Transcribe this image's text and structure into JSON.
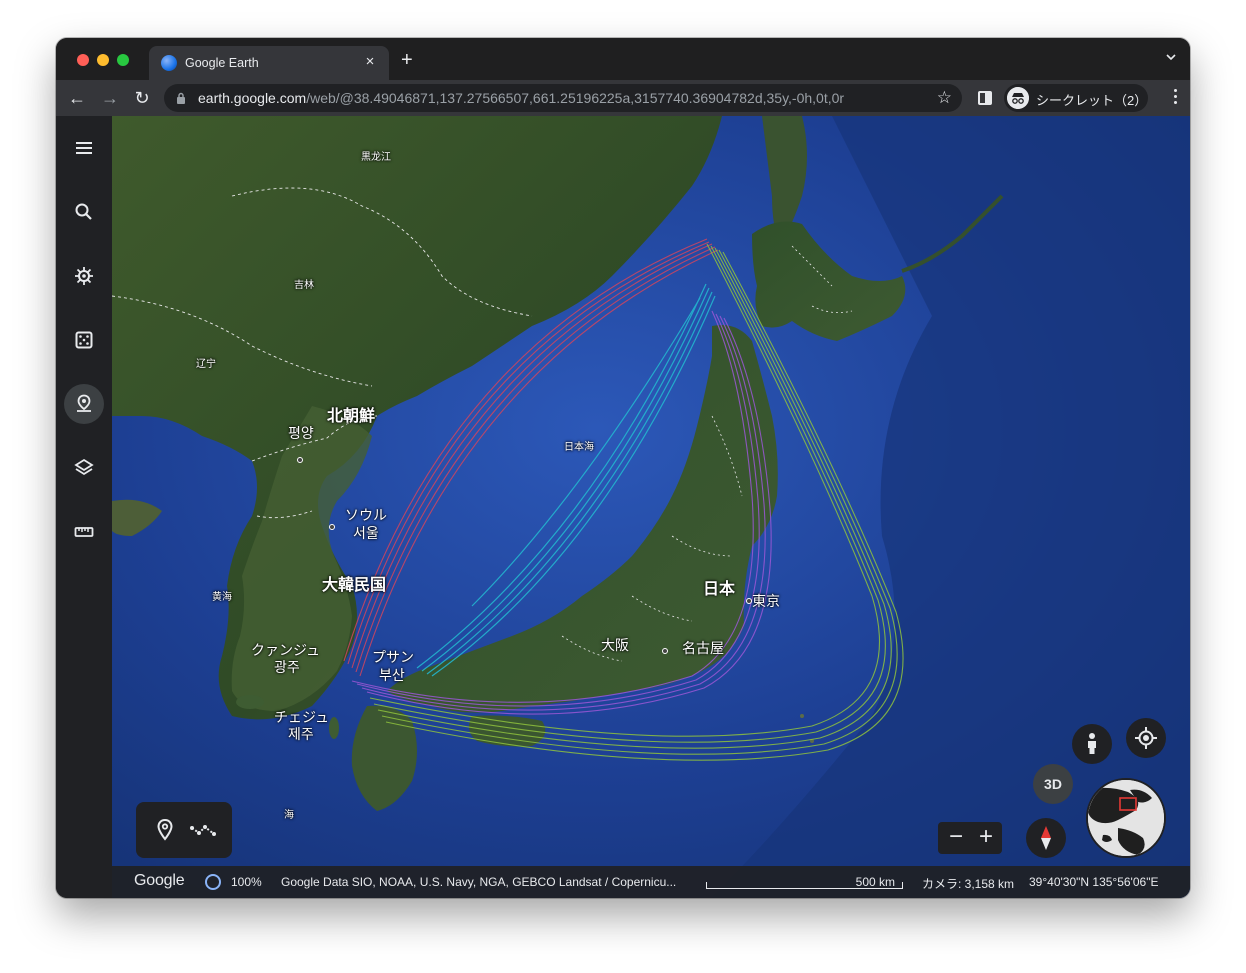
{
  "browser": {
    "tab_title": "Google Earth",
    "tab_close": "×",
    "new_tab": "+",
    "url_host": "earth.google.com",
    "url_path": "/web/@38.49046871,137.27566507,661.25196225a,3157740.36904782d,35y,-0h,0t,0r",
    "incognito_label": "シークレット（2）",
    "back": "←",
    "forward": "→",
    "reload": "↻",
    "star": "☆"
  },
  "sidebar": {
    "items": [
      {
        "name": "menu-icon"
      },
      {
        "name": "search-icon"
      },
      {
        "name": "voyager-icon"
      },
      {
        "name": "feeling-lucky-icon"
      },
      {
        "name": "projects-icon"
      },
      {
        "name": "map-style-icon"
      },
      {
        "name": "measure-icon"
      }
    ]
  },
  "map": {
    "labels": {
      "heilongjiang": "黒龙江",
      "jilin": "吉林",
      "liaoning": "辽宁",
      "north_korea": "北朝鮮",
      "pyongyang": "평양",
      "seoul_kana": "ソウル",
      "seoul": "서울",
      "south_korea": "大韓民国",
      "yellow_sea": "黄海",
      "gwangju_kana": "クァンジュ",
      "gwangju": "광주",
      "busan_kana": "プサン",
      "busan": "부산",
      "jeju_kana": "チェジュ",
      "jeju": "제주",
      "sea_of_japan": "日本海",
      "japan": "日本",
      "tokyo": "東京",
      "osaka": "大阪",
      "nagoya": "名古屋",
      "sea_fragment": "海"
    },
    "route_colors": {
      "red": "#d2455e",
      "cyan": "#23b6cf",
      "purple": "#9b57d6",
      "green": "#8fc23d"
    }
  },
  "controls": {
    "btn_3d": "3D",
    "zoom_out": "−",
    "zoom_in": "+"
  },
  "status": {
    "google": "Google",
    "progress": "100%",
    "attribution": "Google  Data SIO, NOAA, U.S. Navy, NGA, GEBCO  Landsat / Copernicu...",
    "scale": "500 km",
    "camera": "カメラ: 3,158 km",
    "coords": "39°40'30\"N 135°56'06\"E"
  }
}
